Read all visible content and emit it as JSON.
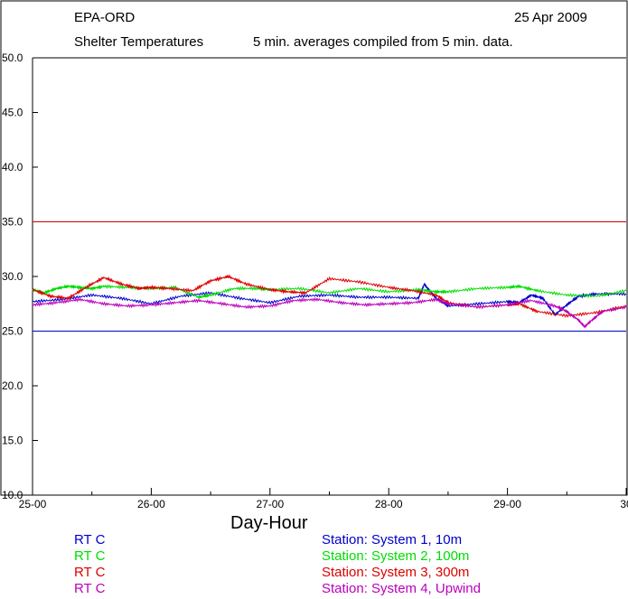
{
  "header": {
    "org": "EPA-ORD",
    "date": "25 Apr 2009",
    "title": "Shelter Temperatures",
    "subtitle": "5 min. averages compiled from 5 min. data."
  },
  "chart_data": {
    "type": "line",
    "xlabel": "Day-Hour",
    "ylabel": "",
    "xlim": [
      25,
      30
    ],
    "ylim": [
      10,
      50
    ],
    "x_ticks": [
      25,
      26,
      27,
      28,
      29,
      30
    ],
    "x_tick_labels": [
      "25-00",
      "26-00",
      "27-00",
      "28-00",
      "29-00",
      "30"
    ],
    "y_ticks": [
      10,
      15,
      20,
      25,
      30,
      35,
      40,
      45,
      50
    ],
    "y_tick_labels": [
      "10.0",
      "15.0",
      "20.0",
      "25.0",
      "30.0",
      "35.0",
      "40.0",
      "45.0",
      "50.0"
    ],
    "grid": false,
    "reference_lines": [
      {
        "y": 50,
        "color": "#000000"
      },
      {
        "y": 35,
        "color": "#cc0000"
      },
      {
        "y": 25,
        "color": "#0000cc"
      }
    ],
    "series": [
      {
        "name": "Station: System 1, 10m",
        "units": "RT  C",
        "color": "#0000cc",
        "x": [
          25.0,
          25.25,
          25.5,
          25.75,
          26.0,
          26.25,
          26.5,
          26.75,
          27.0,
          27.25,
          27.5,
          27.75,
          28.0,
          28.25,
          28.3,
          28.35,
          28.4,
          28.5,
          28.75,
          29.0,
          29.1,
          29.2,
          29.3,
          29.4,
          29.5,
          29.6,
          29.75,
          30.0
        ],
        "y": [
          27.7,
          27.9,
          28.3,
          28.0,
          27.5,
          28.2,
          28.5,
          28.0,
          27.6,
          28.2,
          28.3,
          28.1,
          28.1,
          28.0,
          29.3,
          28.6,
          28.0,
          27.3,
          27.5,
          27.7,
          27.6,
          28.3,
          28.0,
          26.5,
          27.4,
          28.2,
          28.4,
          28.4
        ]
      },
      {
        "name": "Station: System 2, 100m",
        "units": "RT  C",
        "color": "#00dd00",
        "x": [
          25.0,
          25.1,
          25.2,
          25.3,
          25.4,
          25.5,
          25.6,
          25.8,
          26.0,
          26.2,
          26.4,
          26.5,
          26.7,
          26.9,
          27.0,
          27.25,
          27.5,
          27.75,
          28.0,
          28.25,
          28.4,
          28.5,
          28.75,
          29.0,
          29.1,
          29.25,
          29.5,
          29.75,
          30.0
        ],
        "y": [
          28.8,
          28.5,
          28.9,
          29.1,
          29.0,
          28.9,
          29.1,
          29.0,
          28.9,
          29.0,
          28.1,
          28.3,
          28.9,
          28.9,
          28.8,
          28.9,
          28.5,
          28.9,
          28.6,
          28.8,
          28.6,
          28.6,
          28.9,
          29.0,
          29.1,
          28.7,
          28.3,
          28.2,
          28.7
        ]
      },
      {
        "name": "Station: System 3, 300m",
        "units": "RT  C",
        "color": "#dd0000",
        "x": [
          25.0,
          25.15,
          25.3,
          25.45,
          25.6,
          25.75,
          25.9,
          26.0,
          26.15,
          26.35,
          26.5,
          26.65,
          26.8,
          27.0,
          27.15,
          27.3,
          27.5,
          27.75,
          28.0,
          28.2,
          28.4,
          28.5,
          28.75,
          29.0,
          29.1,
          29.25,
          29.5,
          29.75,
          30.0
        ],
        "y": [
          28.8,
          28.2,
          28.0,
          29.0,
          29.9,
          29.3,
          28.9,
          29.0,
          28.9,
          28.7,
          29.6,
          30.0,
          29.3,
          28.8,
          28.6,
          28.5,
          29.8,
          29.5,
          29.0,
          28.7,
          28.3,
          27.6,
          27.2,
          27.4,
          27.5,
          26.8,
          26.4,
          26.7,
          27.3
        ]
      },
      {
        "name": "Station: System 4, Upwind",
        "units": "RT  C",
        "color": "#bb00bb",
        "x": [
          25.0,
          25.2,
          25.4,
          25.6,
          25.8,
          26.0,
          26.2,
          26.4,
          26.6,
          26.8,
          27.0,
          27.2,
          27.4,
          27.6,
          27.8,
          28.0,
          28.2,
          28.4,
          28.5,
          28.75,
          29.0,
          29.2,
          29.4,
          29.5,
          29.6,
          29.65,
          29.7,
          29.8,
          30.0
        ],
        "y": [
          27.4,
          27.6,
          27.9,
          27.5,
          27.3,
          27.4,
          27.6,
          27.8,
          27.5,
          27.2,
          27.3,
          27.8,
          27.9,
          27.6,
          27.4,
          27.5,
          27.6,
          27.9,
          27.5,
          27.2,
          27.4,
          27.8,
          27.3,
          26.8,
          26.0,
          25.4,
          25.9,
          26.8,
          27.2
        ]
      }
    ]
  }
}
